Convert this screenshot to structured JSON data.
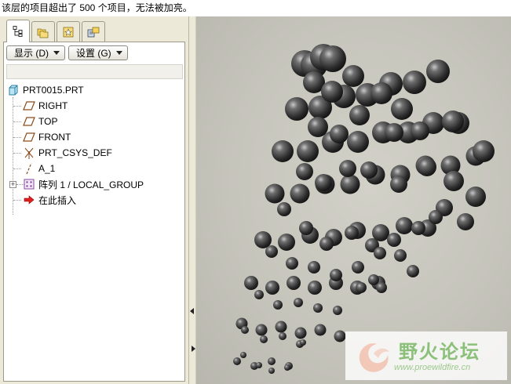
{
  "status_message": "该层的项目超出了 500 个项目，无法被加亮。",
  "tabs": [
    {
      "name": "model-tree-tab",
      "icon": "model-tree-icon",
      "active": true
    },
    {
      "name": "folder-browser-tab",
      "icon": "folders-icon",
      "active": false
    },
    {
      "name": "favorites-tab",
      "icon": "favorites-icon",
      "active": false
    },
    {
      "name": "connections-tab",
      "icon": "connections-icon",
      "active": false
    }
  ],
  "toolbar": {
    "display_label": "显示 (D)",
    "settings_label": "设置 (G)"
  },
  "tree": {
    "root": {
      "label": "PRT0015.PRT",
      "icon": "part-icon"
    },
    "items": [
      {
        "label": "RIGHT",
        "icon": "datum-plane-icon"
      },
      {
        "label": "TOP",
        "icon": "datum-plane-icon"
      },
      {
        "label": "FRONT",
        "icon": "datum-plane-icon"
      },
      {
        "label": "PRT_CSYS_DEF",
        "icon": "coordinate-system-icon"
      },
      {
        "label": "A_1",
        "icon": "datum-axis-icon"
      },
      {
        "label": "阵列 1 / LOCAL_GROUP",
        "icon": "pattern-icon",
        "expandable": true
      },
      {
        "label": "在此插入",
        "icon": "insert-here-arrow-icon"
      }
    ]
  },
  "watermark": {
    "title": "野火论坛",
    "url": "www.proewildfire.cn"
  }
}
